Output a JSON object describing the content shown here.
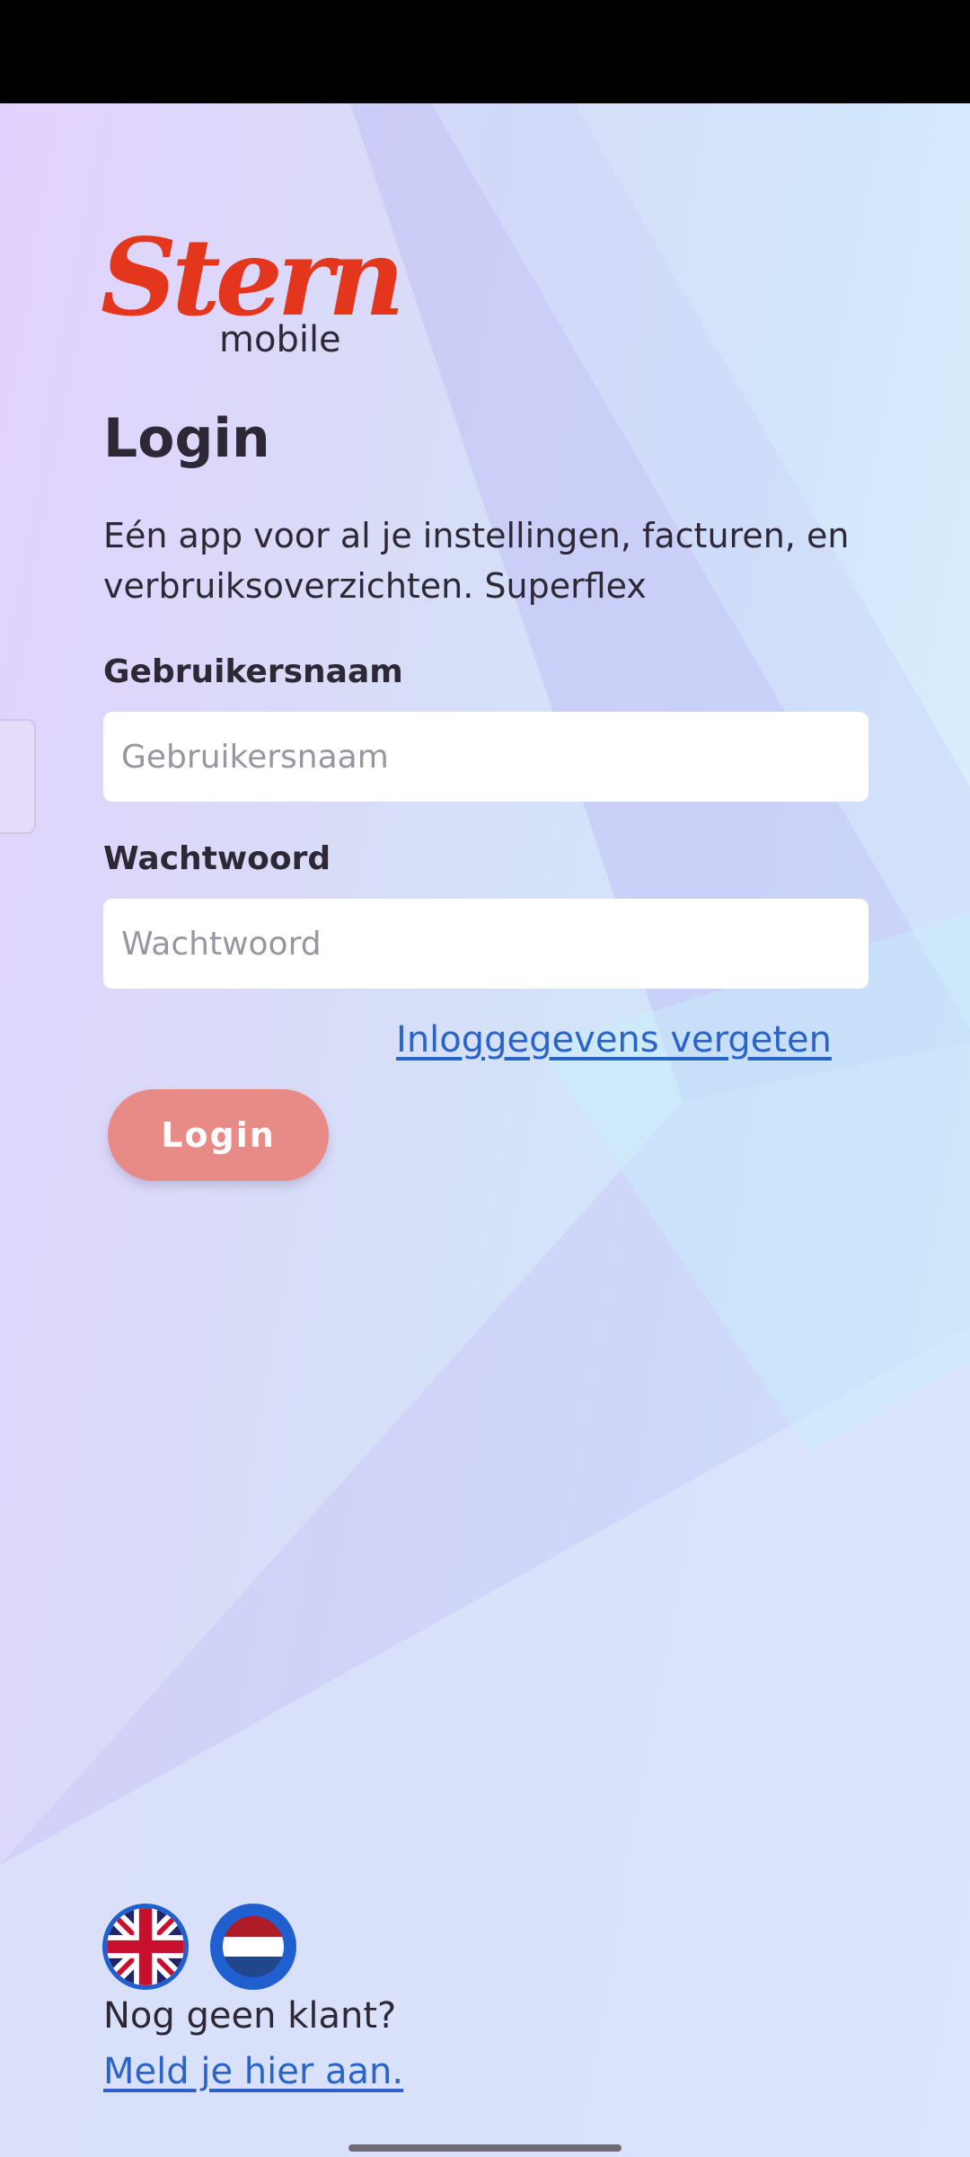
{
  "logo": {
    "script": "Stern",
    "sub": "mobile"
  },
  "login": {
    "title": "Login",
    "intro": "Eén app voor al je instellingen, facturen, en verbruiksoverzichten. Superflex",
    "username_label": "Gebruikersnaam",
    "username_placeholder": "Gebruikersnaam",
    "password_label": "Wachtwoord",
    "password_placeholder": "Wachtwoord",
    "forgot_link": "Inloggegevens vergeten",
    "submit_label": "Login"
  },
  "footer": {
    "languages": [
      {
        "name": "English",
        "icon": "uk-flag-icon"
      },
      {
        "name": "Nederlands",
        "icon": "nl-flag-icon"
      }
    ],
    "no_account_text": "Nog geen klant?",
    "register_link": "Meld je hier aan."
  },
  "colors": {
    "brand_red": "#e4361d",
    "button": "#e88a86",
    "link": "#2a64c8",
    "text": "#2e2836"
  }
}
